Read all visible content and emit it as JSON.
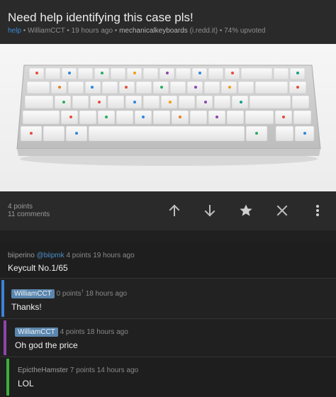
{
  "post": {
    "title": "Need help identifying this case pls!",
    "flair": "help",
    "author": "WilliamCCT",
    "time": "19 hours ago",
    "subreddit": "mechanicalkeyboards",
    "domain": "(i.redd.it)",
    "upvoted": "74% upvoted",
    "points": "4 points",
    "comments_count": "11 comments"
  },
  "actions": {
    "upvote_icon": "arrow-up-icon",
    "downvote_icon": "arrow-down-icon",
    "save_icon": "star-icon",
    "hide_icon": "close-icon",
    "more_icon": "more-vertical-icon"
  },
  "comments": [
    {
      "author": "biiperino",
      "handle": "@biipmk",
      "points": "4 points",
      "time": "19 hours ago",
      "body": "Keycult No.1/65",
      "depth": 0
    },
    {
      "author": "WilliamCCT",
      "points": "0 points",
      "sup": "†",
      "time": "18 hours ago",
      "body": "Thanks!",
      "depth": 1,
      "bar_color": "#3b82d6",
      "op": true
    },
    {
      "author": "WilliamCCT",
      "points": "4 points",
      "time": "18 hours ago",
      "body": "Oh god the price",
      "depth": 2,
      "bar_color": "#8e44ad",
      "op": true
    },
    {
      "author": "EpictheHamster",
      "points": "7 points",
      "time": "14 hours ago",
      "body": "LOL",
      "depth": 3,
      "bar_color": "#3cae3c"
    }
  ],
  "colors": {
    "background": "#2a2a2a",
    "comments_bg": "#1e1e1e",
    "link": "#3a8bd5",
    "op_badge": "#5b86ad"
  }
}
